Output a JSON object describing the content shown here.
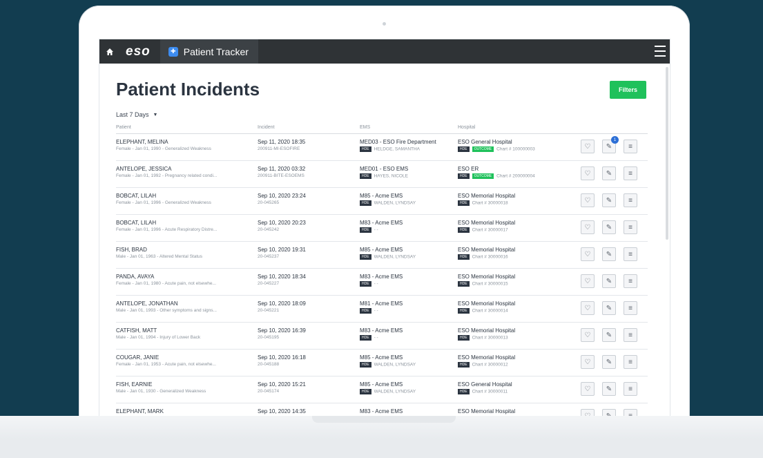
{
  "app": {
    "logo": "eso",
    "tab_name": "Patient Tracker"
  },
  "page": {
    "title": "Patient Incidents",
    "filters_label": "Filters",
    "date_range": "Last 7 Days"
  },
  "columns": [
    "Patient",
    "Incident",
    "EMS",
    "Hospital"
  ],
  "rows": [
    {
      "name": "ELEPHANT, MELINA",
      "detail": "Female - Jan 01, 1990 - Generalized Weakness",
      "date": "Sep 11, 2020 18:35",
      "incident_id": "200911-MI-ESOFIRE",
      "ems": "MED03 - ESO Fire Department",
      "ems_tag": "HDE",
      "crew": "HELDGE, SAMANTHA",
      "hospital": "ESO General Hospital",
      "hosp_tag": "HDE",
      "outcome": "OUTCOME",
      "chart": "Chart # 100000003",
      "badge": "1"
    },
    {
      "name": "ANTELOPE, JESSICA",
      "detail": "Female - Jan 01, 1992 - Pregnancy related condi...",
      "date": "Sep 11, 2020 03:32",
      "incident_id": "200911-BITE-ESOEMS",
      "ems": "MED01 - ESO EMS",
      "ems_tag": "HDE",
      "crew": "HAYES, NICOLE",
      "hospital": "ESO ER",
      "hosp_tag": "HDE",
      "outcome": "OUTCOME",
      "chart": "Chart # 200000004",
      "badge": ""
    },
    {
      "name": "BOBCAT, LILAH",
      "detail": "Female - Jan 01, 1996 - Generalized Weakness",
      "date": "Sep 10, 2020 23:24",
      "incident_id": "20-045265",
      "ems": "M85 - Acme EMS",
      "ems_tag": "HDE",
      "crew": "WALDEN, LYNDSAY",
      "hospital": "ESO Memorial Hospital",
      "hosp_tag": "HDE",
      "outcome": "",
      "chart": "Chart # 30000018",
      "badge": ""
    },
    {
      "name": "BOBCAT, LILAH",
      "detail": "Female - Jan 01, 1996 - Acute Respiratory Distre...",
      "date": "Sep 10, 2020 20:23",
      "incident_id": "20-045242",
      "ems": "M83 - Acme EMS",
      "ems_tag": "HDE",
      "crew": "- -",
      "hospital": "ESO Memorial Hospital",
      "hosp_tag": "HDE",
      "outcome": "",
      "chart": "Chart # 30000017",
      "badge": ""
    },
    {
      "name": "FISH, BRAD",
      "detail": "Male - Jan 01, 1963 - Altered Mental Status",
      "date": "Sep 10, 2020 19:31",
      "incident_id": "20-045237",
      "ems": "M85 - Acme EMS",
      "ems_tag": "HDE",
      "crew": "WALDEN, LYNDSAY",
      "hospital": "ESO Memorial Hospital",
      "hosp_tag": "HDE",
      "outcome": "",
      "chart": "Chart # 30000016",
      "badge": ""
    },
    {
      "name": "PANDA, AVAYA",
      "detail": "Female - Jan 01, 1980 - Acute pain, not elsewhe...",
      "date": "Sep 10, 2020 18:34",
      "incident_id": "20-045227",
      "ems": "M83 - Acme EMS",
      "ems_tag": "HDE",
      "crew": "- -",
      "hospital": "ESO Memorial Hospital",
      "hosp_tag": "HDE",
      "outcome": "",
      "chart": "Chart # 30000015",
      "badge": ""
    },
    {
      "name": "ANTELOPE, JONATHAN",
      "detail": "Male - Jan 01, 1993 - Other symptoms and signs...",
      "date": "Sep 10, 2020 18:09",
      "incident_id": "20-045221",
      "ems": "M81 - Acme EMS",
      "ems_tag": "HDE",
      "crew": "- -",
      "hospital": "ESO Memorial Hospital",
      "hosp_tag": "HDE",
      "outcome": "",
      "chart": "Chart # 30000014",
      "badge": ""
    },
    {
      "name": "CATFISH, MATT",
      "detail": "Male - Jan 01, 1994 - Injury of Lower Back",
      "date": "Sep 10, 2020 16:39",
      "incident_id": "20-045195",
      "ems": "M83 - Acme EMS",
      "ems_tag": "HDE",
      "crew": "- -",
      "hospital": "ESO Memorial Hospital",
      "hosp_tag": "HDE",
      "outcome": "",
      "chart": "Chart # 30000013",
      "badge": ""
    },
    {
      "name": "COUGAR, JANIE",
      "detail": "Female - Jan 01, 1953 - Acute pain, not elsewhe...",
      "date": "Sep 10, 2020 16:18",
      "incident_id": "20-045188",
      "ems": "M85 - Acme EMS",
      "ems_tag": "HDE",
      "crew": "WALDEN, LYNDSAY",
      "hospital": "ESO Memorial Hospital",
      "hosp_tag": "HDE",
      "outcome": "",
      "chart": "Chart # 30000012",
      "badge": ""
    },
    {
      "name": "FISH, EARNIE",
      "detail": "Male - Jan 01, 1930 - Generalized Weakness",
      "date": "Sep 10, 2020 15:21",
      "incident_id": "20-045174",
      "ems": "M85 - Acme EMS",
      "ems_tag": "HDE",
      "crew": "WALDEN, LYNDSAY",
      "hospital": "ESO General Hospital",
      "hosp_tag": "HDE",
      "outcome": "",
      "chart": "Chart # 30000011",
      "badge": ""
    },
    {
      "name": "ELEPHANT, MARK",
      "detail": "",
      "date": "Sep 10, 2020 14:35",
      "incident_id": "",
      "ems": "M83 - Acme EMS",
      "ems_tag": "",
      "crew": "",
      "hospital": "ESO Memorial Hospital",
      "hosp_tag": "",
      "outcome": "",
      "chart": "",
      "badge": ""
    }
  ]
}
